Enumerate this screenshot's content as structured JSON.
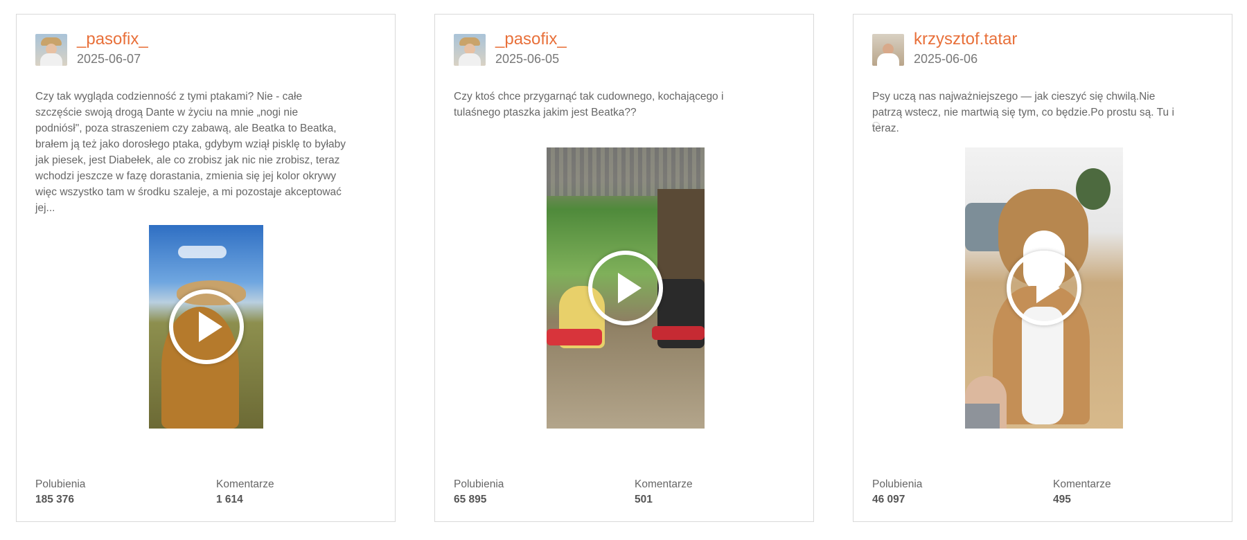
{
  "labels": {
    "likes": "Polubienia",
    "comments": "Komentarze"
  },
  "colors": {
    "accent": "#e8703a",
    "muted_text": "#666666",
    "border": "#d9d9d9"
  },
  "icons": {
    "play": "play-icon",
    "loading": "loading-spinner-icon"
  },
  "posts": [
    {
      "author": "_pasofix_",
      "date": "2025-06-07",
      "text": "Czy tak wygląda codzienność z tymi ptakami? Nie - całe szczęście swoją drogą Dante w życiu na mnie „nogi nie podniósł\", poza straszeniem czy zabawą, ale Beatka to Beatka, brałem ją też jako dorosłego ptaka, gdybym wziął pisklę to byłaby jak piesek, jest Diabełek, ale co zrobisz jak nic nie zrobisz, teraz wchodzi jeszcze w fazę dorastania, zmienia się jej kolor okrywy więc wszystko tam w środku szaleje, a mi pozostaje akceptować jej...",
      "likes": "185 376",
      "comments": "1 614"
    },
    {
      "author": "_pasofix_",
      "date": "2025-06-05",
      "text": "Czy ktoś chce przygarnąć tak cudownego, kochającego i tulaśnego ptaszka jakim jest Beatka??",
      "likes": "65 895",
      "comments": "501"
    },
    {
      "author": "krzysztof.tatar",
      "date": "2025-06-06",
      "text": "Psy uczą nas najważniejszego — jak cieszyć się chwilą.Nie patrzą wstecz, nie martwią się tym, co będzie.Po prostu są. Tu i teraz.",
      "likes": "46 097",
      "comments": "495"
    }
  ]
}
